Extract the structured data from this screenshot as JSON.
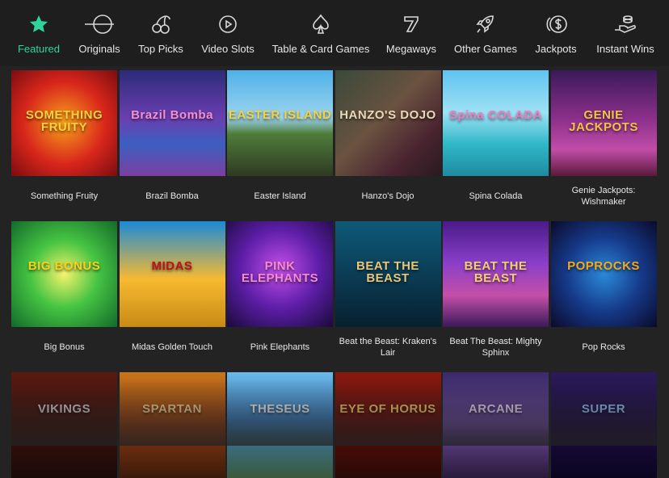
{
  "nav": {
    "items": [
      {
        "label": "Featured",
        "icon": "star-icon"
      },
      {
        "label": "Originals",
        "icon": "originals-icon"
      },
      {
        "label": "Top Picks",
        "icon": "cherries-icon"
      },
      {
        "label": "Video Slots",
        "icon": "play-icon"
      },
      {
        "label": "Table & Card Games",
        "icon": "spade-icon"
      },
      {
        "label": "Megaways",
        "icon": "seven-icon"
      },
      {
        "label": "Other Games",
        "icon": "rocket-icon"
      },
      {
        "label": "Jackpots",
        "icon": "dollar-coins-icon"
      },
      {
        "label": "Instant Wins",
        "icon": "hand-coins-icon"
      }
    ],
    "active_color": "#2fd49a"
  },
  "games": [
    {
      "name": "Something Fruity",
      "art": "SOMETHING FRUITY",
      "bg": "radial-gradient(circle at 50% 50%, #f7a21b 0%, #d8261b 55%, #7a0d10 100%)",
      "fg": "#ffd23a"
    },
    {
      "name": "Brazil Bomba",
      "art": "Brazil Bomba",
      "bg": "linear-gradient(#2c2b7a 0%, #6a3fb0 45%, #3c5fc0 70%, #7b3fa0 100%)",
      "fg": "#f58fd0"
    },
    {
      "name": "Easter Island",
      "art": "EASTER ISLAND",
      "bg": "linear-gradient(#4fb1e8 0%, #9bd4ef 45%, #4f7d3a 60%, #2e3a22 100%)",
      "fg": "#f6d33c"
    },
    {
      "name": "Hanzo's Dojo",
      "art": "HANZO'S DOJO",
      "bg": "linear-gradient(135deg, #3a4a3a 0%, #6a5240 45%, #4a2430 75%, #2a1a20 100%)",
      "fg": "#e9d8b8"
    },
    {
      "name": "Spina Colada",
      "art": "Spina COLADA",
      "bg": "linear-gradient(#5fc3f0 0%, #9ee1f5 40%, #2fb8c8 70%, #1f8aa0 100%)",
      "fg": "#f27bc0"
    },
    {
      "name": "Genie Jackpots: Wishmaker",
      "art": "GENIE JACKPOTS",
      "bg": "linear-gradient(#3a1a5a 0%, #8a2f8a 45%, #c14da8 75%, #5a1a3a 100%)",
      "fg": "#f3c246"
    },
    {
      "name": "Big Bonus",
      "art": "BIG BONUS",
      "bg": "radial-gradient(circle at 50% 50%, #f6f36a 0%, #46c443 45%, #126a2a 100%)",
      "fg": "#f6d21a"
    },
    {
      "name": "Midas Golden Touch",
      "art": "MIDAS",
      "bg": "linear-gradient(#1a8ad8 0%, #f7b930 55%, #c88a14 100%)",
      "fg": "#b8121a"
    },
    {
      "name": "Pink Elephants",
      "art": "PINK ELEPHANTS",
      "bg": "radial-gradient(circle at 50% 45%, #c44fe8 0%, #5d1ea8 50%, #1a0a3a 100%)",
      "fg": "#f78ad0"
    },
    {
      "name": "Beat the Beast: Kraken's Lair",
      "art": "BEAT THE BEAST",
      "bg": "linear-gradient(#0e5a78 0%, #0b3a52 55%, #07202e 100%)",
      "fg": "#e8c878"
    },
    {
      "name": "Beat The Beast: Mighty Sphinx",
      "art": "BEAT THE BEAST",
      "bg": "linear-gradient(#4a1a8a 0%, #8a3fc8 40%, #c44fa8 70%, #3a1a5a 100%)",
      "fg": "#f6d070"
    },
    {
      "name": "Pop Rocks",
      "art": "POPROCKS",
      "bg": "radial-gradient(circle at 50% 50%, #2a8ad8 0%, #163a8a 50%, #0a0a2a 100%)",
      "fg": "#f7a81a"
    },
    {
      "name": "",
      "art": "VIKINGS",
      "bg": "linear-gradient(#5a1a10 0%, #3a120c 50%, #1a0a08 100%)",
      "fg": "#c8c8c8"
    },
    {
      "name": "",
      "art": "SPARTAN",
      "bg": "linear-gradient(#c8761a 0%, #8a3a12 50%, #3a1a0a 100%)",
      "fg": "#e8c890"
    },
    {
      "name": "",
      "art": "THESEUS",
      "bg": "linear-gradient(#6ab8e8 0%, #3a7ab8 45%, #3a5a3a 100%)",
      "fg": "#e8e8e8"
    },
    {
      "name": "",
      "art": "EYE OF HORUS",
      "bg": "linear-gradient(#8a1a10 0%, #5a0c08 50%, #2a0a06 100%)",
      "fg": "#e8c060"
    },
    {
      "name": "",
      "art": "ARCANE",
      "bg": "linear-gradient(#3a2a6a 0%, #6a4a9a 50%, #2a1a3a 100%)",
      "fg": "#e0d0f0"
    },
    {
      "name": "",
      "art": "SUPER",
      "bg": "linear-gradient(#2a1a5a 0%, #1a0a3a 60%, #0a0520 100%)",
      "fg": "#8ab8f0"
    }
  ]
}
